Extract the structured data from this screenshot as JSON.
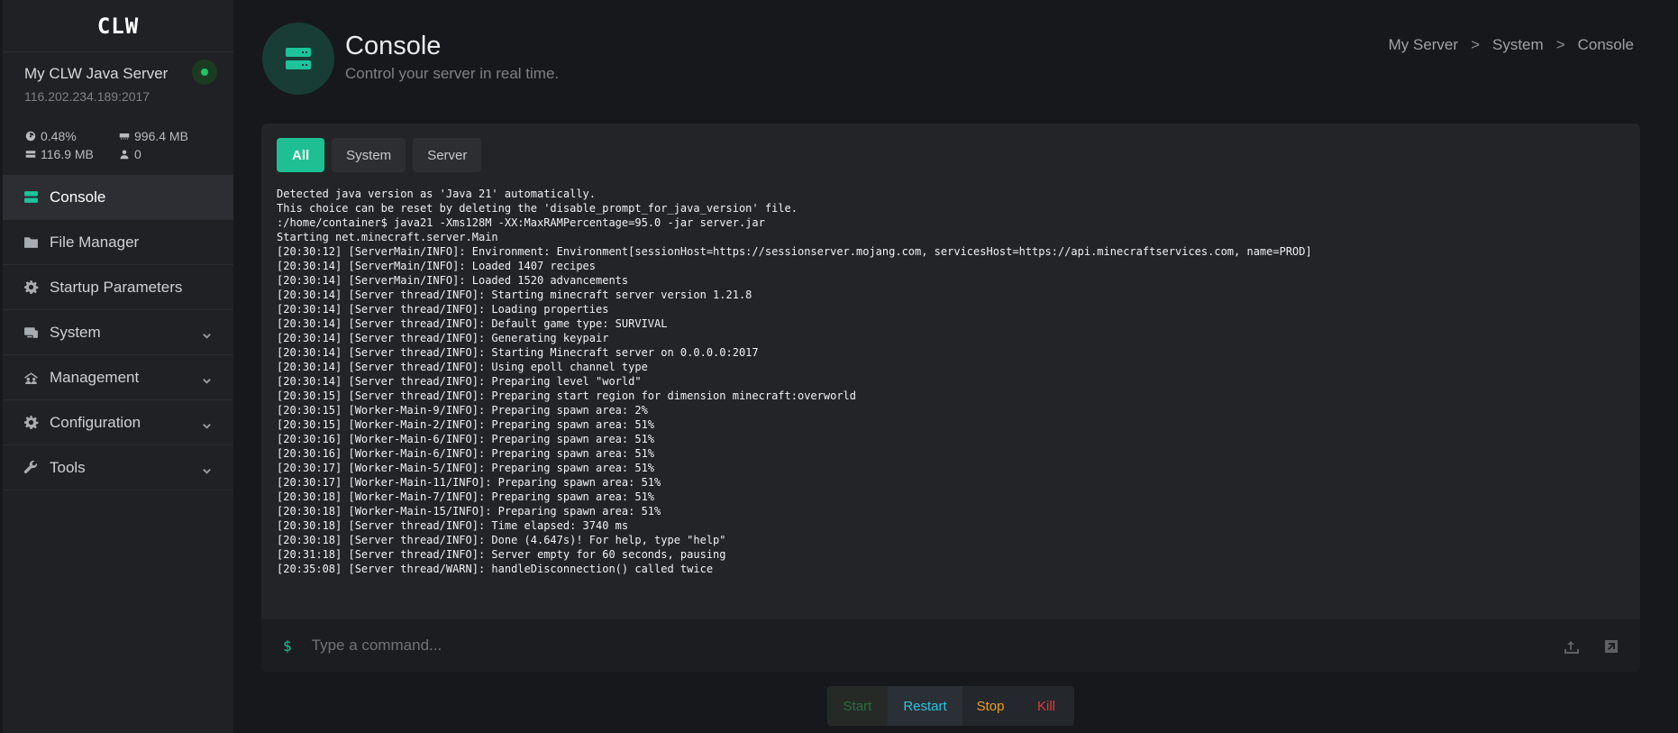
{
  "app": {
    "logo": "CLW"
  },
  "server": {
    "name": "My CLW Java Server",
    "address": "116.202.234.189:2017",
    "status_color": "#22c55e",
    "stats": {
      "cpu": "0.48%",
      "memory": "996.4 MB",
      "disk": "116.9 MB",
      "players": "0"
    }
  },
  "sidebar": {
    "items": [
      {
        "label": "Console",
        "icon": "server-icon",
        "active": true
      },
      {
        "label": "File Manager",
        "icon": "folder-icon"
      },
      {
        "label": "Startup Parameters",
        "icon": "gear-icon"
      },
      {
        "label": "System",
        "icon": "network-icon",
        "expandable": true
      },
      {
        "label": "Management",
        "icon": "users-icon",
        "expandable": true
      },
      {
        "label": "Configuration",
        "icon": "gear-icon",
        "expandable": true
      },
      {
        "label": "Tools",
        "icon": "wrench-icon",
        "expandable": true
      }
    ]
  },
  "header": {
    "title": "Console",
    "subtitle": "Control your server in real time.",
    "breadcrumb": [
      "My Server",
      "System",
      "Console"
    ],
    "breadcrumb_sep": ">"
  },
  "console": {
    "tabs": [
      "All",
      "System",
      "Server"
    ],
    "active_tab": "All",
    "lines": [
      "Detected java version as 'Java 21' automatically.",
      "This choice can be reset by deleting the 'disable_prompt_for_java_version' file.",
      ":/home/container$ java21 -Xms128M -XX:MaxRAMPercentage=95.0 -jar server.jar",
      "Starting net.minecraft.server.Main",
      "[20:30:12] [ServerMain/INFO]: Environment: Environment[sessionHost=https://sessionserver.mojang.com, servicesHost=https://api.minecraftservices.com, name=PROD]",
      "[20:30:14] [ServerMain/INFO]: Loaded 1407 recipes",
      "[20:30:14] [ServerMain/INFO]: Loaded 1520 advancements",
      "[20:30:14] [Server thread/INFO]: Starting minecraft server version 1.21.8",
      "[20:30:14] [Server thread/INFO]: Loading properties",
      "[20:30:14] [Server thread/INFO]: Default game type: SURVIVAL",
      "[20:30:14] [Server thread/INFO]: Generating keypair",
      "[20:30:14] [Server thread/INFO]: Starting Minecraft server on 0.0.0.0:2017",
      "[20:30:14] [Server thread/INFO]: Using epoll channel type",
      "[20:30:14] [Server thread/INFO]: Preparing level \"world\"",
      "[20:30:15] [Server thread/INFO]: Preparing start region for dimension minecraft:overworld",
      "[20:30:15] [Worker-Main-9/INFO]: Preparing spawn area: 2%",
      "[20:30:15] [Worker-Main-2/INFO]: Preparing spawn area: 51%",
      "[20:30:16] [Worker-Main-6/INFO]: Preparing spawn area: 51%",
      "[20:30:16] [Worker-Main-6/INFO]: Preparing spawn area: 51%",
      "[20:30:17] [Worker-Main-5/INFO]: Preparing spawn area: 51%",
      "[20:30:17] [Worker-Main-11/INFO]: Preparing spawn area: 51%",
      "[20:30:18] [Worker-Main-7/INFO]: Preparing spawn area: 51%",
      "[20:30:18] [Worker-Main-15/INFO]: Preparing spawn area: 51%",
      "[20:30:18] [Server thread/INFO]: Time elapsed: 3740 ms",
      "[20:30:18] [Server thread/INFO]: Done (4.647s)! For help, type \"help\"",
      "[20:31:18] [Server thread/INFO]: Server empty for 60 seconds, pausing",
      "[20:35:08] [Server thread/WARN]: handleDisconnection() called twice"
    ],
    "prompt": "$",
    "command_placeholder": "Type a command...",
    "command_value": ""
  },
  "power": {
    "start": "Start",
    "restart": "Restart",
    "stop": "Stop",
    "kill": "Kill"
  },
  "colors": {
    "accent": "#1fbf94",
    "restart": "#2fc1e0",
    "stop": "#f0a020",
    "kill": "#e23b3b",
    "start": "#2e6b3f"
  }
}
